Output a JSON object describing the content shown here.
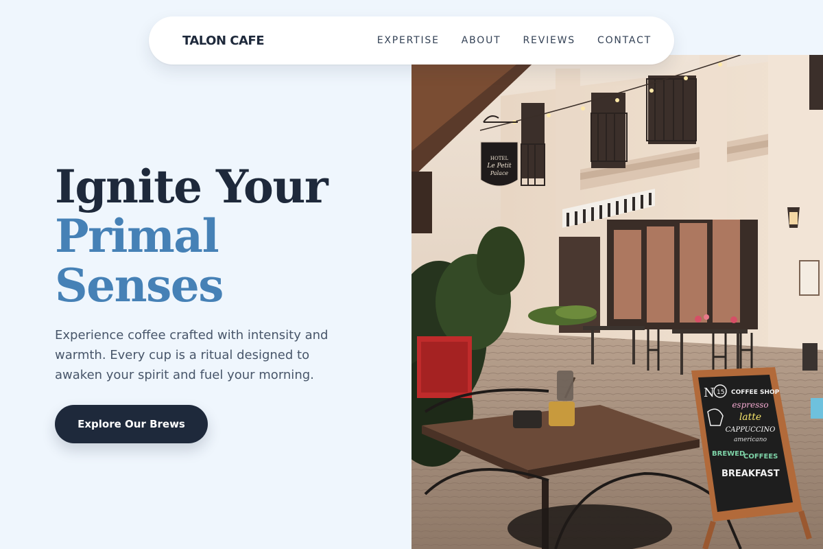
{
  "nav": {
    "brand": "TALON CAFE",
    "links": [
      "EXPERTISE",
      "ABOUT",
      "REVIEWS",
      "CONTACT"
    ]
  },
  "hero": {
    "headline_line1": "Ignite Your",
    "headline_accent_line1": "Primal",
    "headline_accent_line2": "Senses",
    "description": "Experience coffee crafted with intensity and warmth. Every cup is a ritual designed to awaken your spirit and fuel your morning.",
    "cta_label": "Explore Our Brews"
  },
  "photo": {
    "subject": "cafe-street-terrace",
    "hanging_sign": [
      "HOTEL",
      "Le Petit",
      "Palace"
    ],
    "chalkboard": [
      "N",
      "15",
      "COFFEE SHOP",
      "espresso",
      "latte",
      "CAPPUCCINO",
      "americano",
      "BREWED",
      "COFFEES",
      "BREAKFAST"
    ]
  },
  "colors": {
    "background": "#eff6fd",
    "dark": "#1e293b",
    "accent": "#4681b6",
    "body_text": "#475569"
  }
}
